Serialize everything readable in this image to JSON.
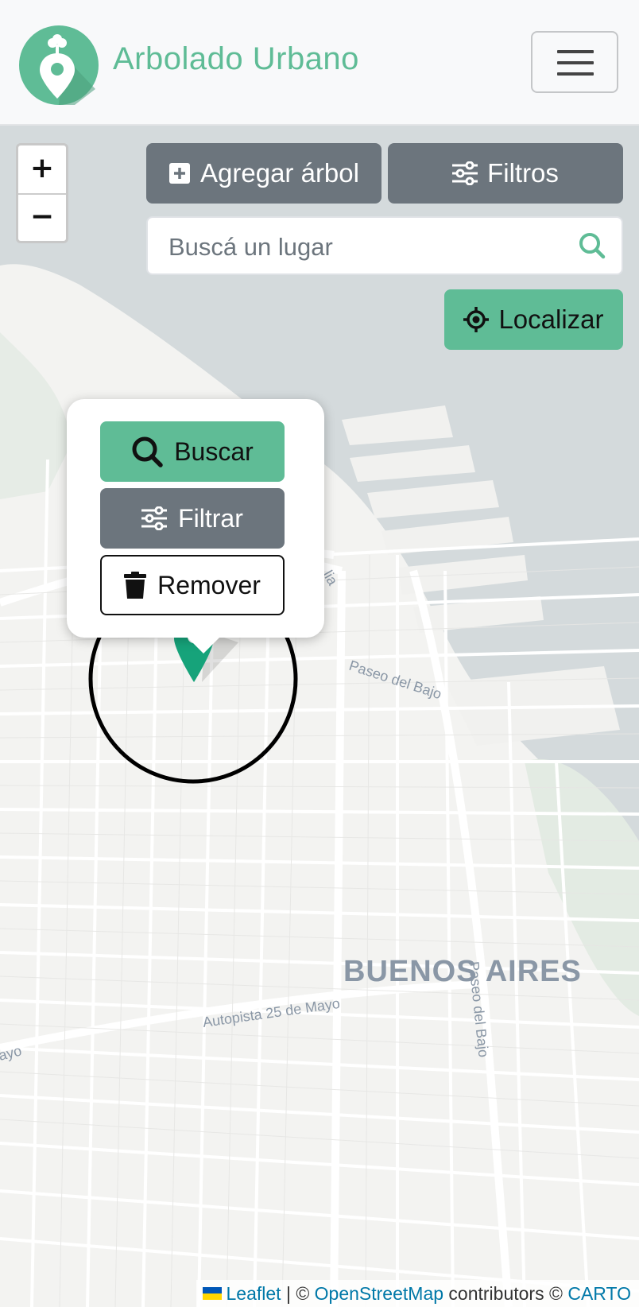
{
  "app": {
    "brand": "Arbolado Urbano",
    "logo_icon": "tree-pin-icon",
    "menu_icon": "hamburger-icon"
  },
  "colors": {
    "brand_green": "#5fbc96",
    "gray": "#6c757d",
    "marker": "#16a37a"
  },
  "map": {
    "zoom_in": "+",
    "zoom_out": "−",
    "city_label": "BUENOS AIRES",
    "street_labels": [
      "Paseo del Bajo",
      "Paseo del Bajo",
      "Autopista 25 de Mayo",
      "ayo",
      "lia"
    ]
  },
  "toolbar": {
    "add_tree": "Agregar árbol",
    "filters": "Filtros",
    "locate": "Localizar"
  },
  "search": {
    "placeholder": "Buscá un lugar"
  },
  "popup": {
    "search": "Buscar",
    "filter": "Filtrar",
    "remove": "Remover"
  },
  "attribution": {
    "leaflet": "Leaflet",
    "sep": " | © ",
    "osm": "OpenStreetMap",
    "contributors": " contributors © ",
    "carto": "CARTO"
  }
}
